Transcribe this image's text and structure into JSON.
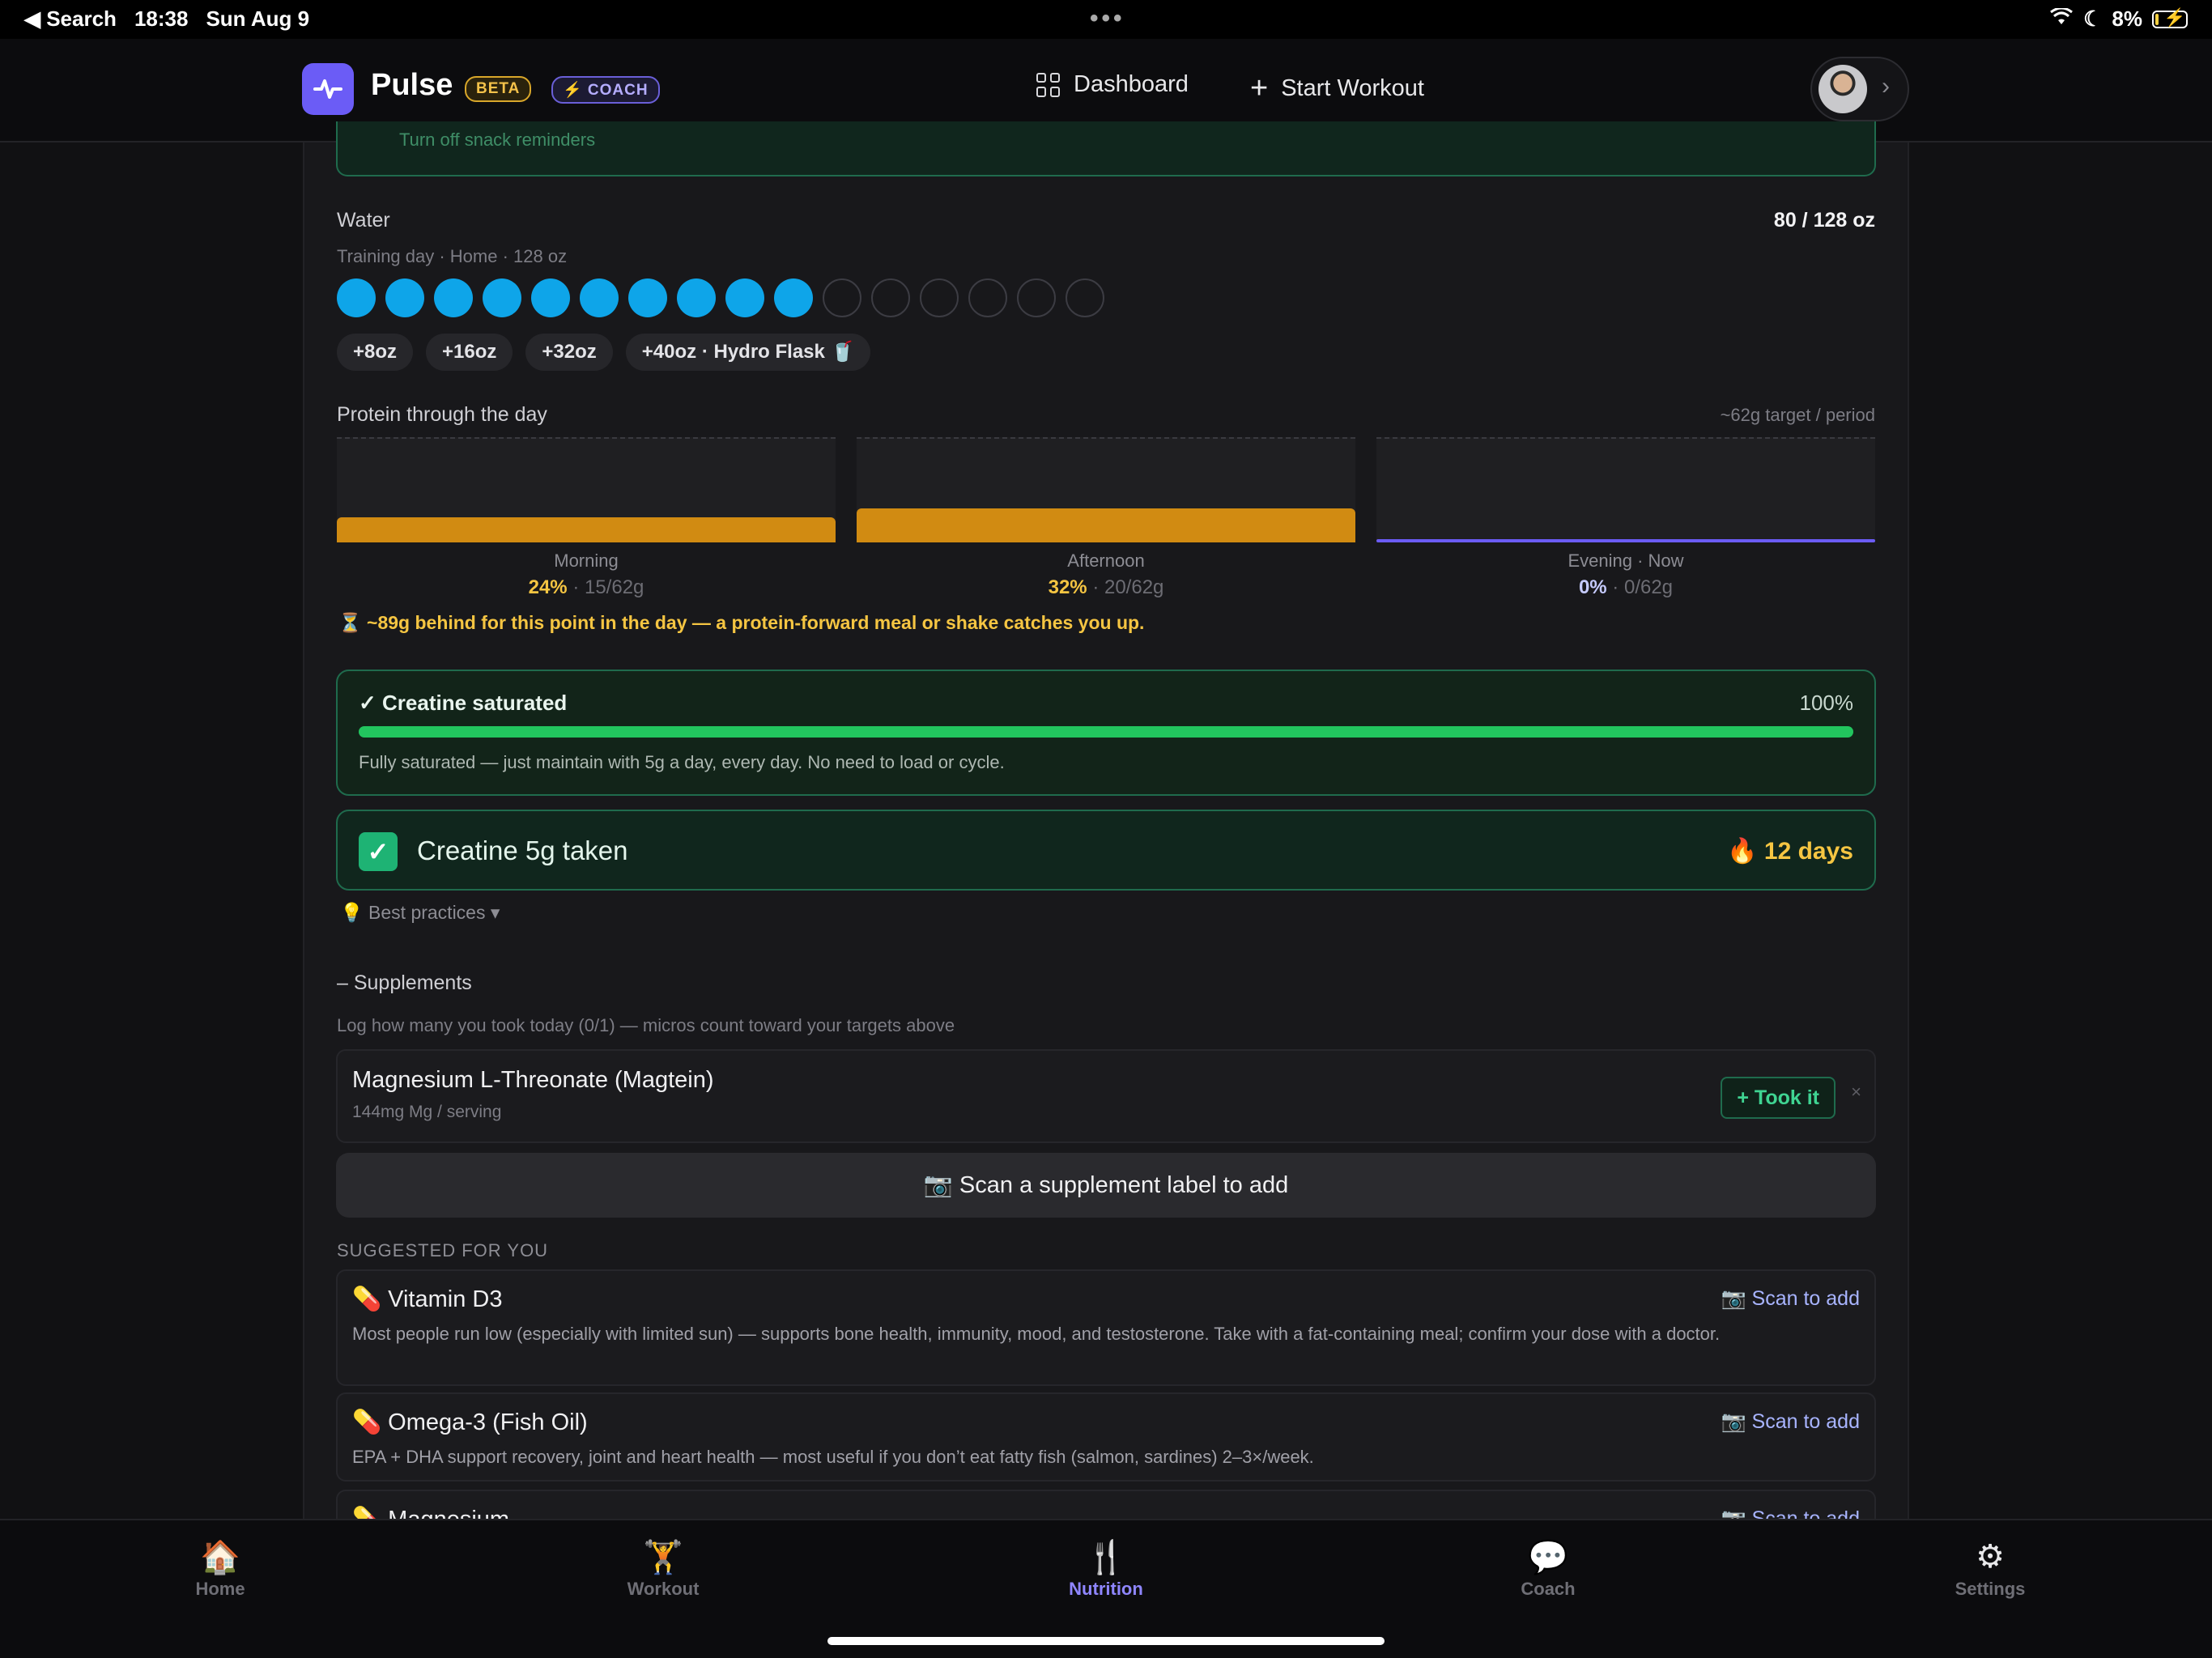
{
  "status_bar": {
    "back": "◀ Search",
    "time": "18:38",
    "date": "Sun Aug 9",
    "battery": "8%"
  },
  "nav": {
    "brand": "Pulse",
    "badge_beta": "BETA",
    "badge_coach": "⚡ COACH",
    "dashboard": "Dashboard",
    "start_workout": "Start Workout"
  },
  "prev_card": {
    "text": "Turn off snack reminders"
  },
  "water": {
    "title": "Water",
    "amount": "80 / 128 oz",
    "subtitle": "Training day · Home · 128 oz",
    "filled": 10,
    "total": 16,
    "chips": [
      "+8oz",
      "+16oz",
      "+32oz",
      "+40oz · Hydro Flask 🥤"
    ]
  },
  "protein": {
    "title": "Protein through the day",
    "target": "~62g target / period",
    "periods": [
      {
        "label": "Morning",
        "pct": "24%",
        "amount": " · 15/62g",
        "fill": 0.24
      },
      {
        "label": "Afternoon",
        "pct": "32%",
        "amount": " · 20/62g",
        "fill": 0.32
      },
      {
        "label": "Evening · Now",
        "pct": "0%",
        "amount": " · 0/62g",
        "fill": 0
      }
    ],
    "behind": "⏳ ~89g behind for this point in the day — a protein-forward meal or shake catches you up."
  },
  "creatine_saturation": {
    "title": "✓ Creatine saturated",
    "pct": "100%",
    "fill": 1.0,
    "desc": "Fully saturated — just maintain with 5g a day, every day. No need to load or cycle."
  },
  "creatine_taken": {
    "label": "Creatine 5g taken",
    "streak": "🔥 12 days"
  },
  "best_practices": "💡 Best practices ▾",
  "supplements": {
    "heading": "– Supplements",
    "subtitle": "Log how many you took today (0/1) — micros count toward your targets above",
    "items": [
      {
        "name": "Magnesium L-Threonate (Magtein)",
        "dose": "144mg Mg / serving",
        "action": "+ Took it",
        "remove": "×"
      }
    ],
    "scan_button": "📷 Scan a supplement label to add"
  },
  "suggested": {
    "heading": "SUGGESTED FOR YOU",
    "items": [
      {
        "name": "💊 Vitamin D3",
        "action": "📷 Scan to add",
        "desc": "Most people run low (especially with limited sun) — supports bone health, immunity, mood, and testosterone. Take with a fat-containing meal; confirm your dose with a doctor."
      },
      {
        "name": "💊 Omega-3 (Fish Oil)",
        "action": "📷 Scan to add",
        "desc": "EPA + DHA support recovery, joint and heart health — most useful if you don’t eat fatty fish (salmon, sardines) 2–3×/week."
      },
      {
        "name": "💊 Magnesium",
        "action": "📷 Scan to add",
        "desc": ""
      }
    ]
  },
  "tabs": [
    {
      "label": "Home",
      "icon": "🏠"
    },
    {
      "label": "Workout",
      "icon": "🏋"
    },
    {
      "label": "Nutrition",
      "icon": "🍴"
    },
    {
      "label": "Coach",
      "icon": "💬"
    },
    {
      "label": "Settings",
      "icon": "⚙"
    }
  ],
  "active_tab": "Nutrition"
}
